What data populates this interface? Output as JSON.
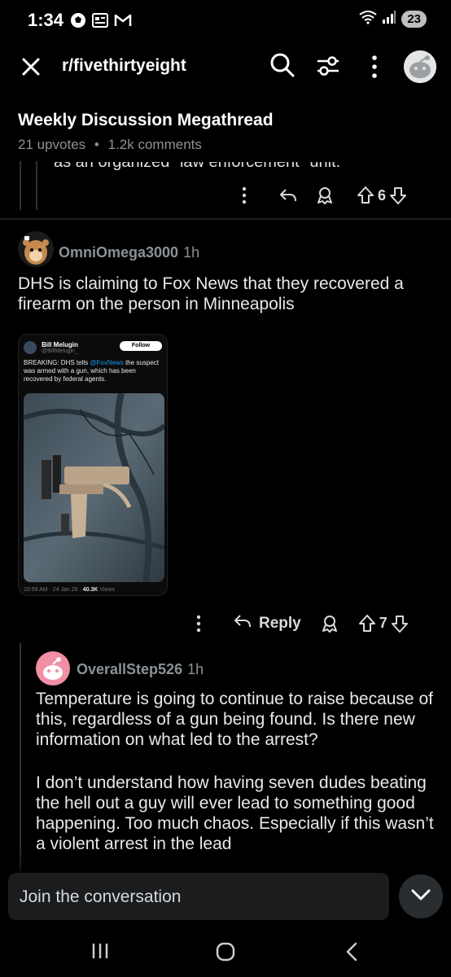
{
  "status_bar": {
    "time": "1:34",
    "battery": "23"
  },
  "header": {
    "subreddit": "r/fivethirtyeight"
  },
  "thread": {
    "title": "Weekly Discussion Megathread",
    "upvotes": "21 upvotes",
    "separator": "•",
    "comments": "1.2k comments"
  },
  "prev_comment": {
    "partial_text": "as an organized \"law enforcement\" unit.",
    "vote_count": "6"
  },
  "comment": {
    "username": "OmniOmega3000",
    "age": "1h",
    "body": "DHS is claiming to Fox News that they recovered a firearm on the person in Minneapolis",
    "reply_label": "Reply",
    "vote_count": "7",
    "embed": {
      "author": "Bill Melugin",
      "handle": "@BillMelugin_",
      "follow_label": "Follow",
      "text_prefix": "BREAKING: DHS tells",
      "mention": "@FoxNews",
      "text_suffix": "the suspect was armed with a gun, which has been recovered by federal agents.",
      "timestamp": "10:59 AM · 24 Jan 26 ·",
      "views": "40.3K",
      "views_label": "Views"
    }
  },
  "reply": {
    "username": "OverallStep526",
    "age": "1h",
    "paragraph1": "Temperature is going to continue to raise because of this, regardless of a gun being found. Is there new information on what led to the arrest?",
    "paragraph2": "I don’t understand how having seven dudes beating the hell out a guy will ever lead to something good happening. Too much chaos. Especially if this wasn’t a violent arrest in the lead"
  },
  "composer": {
    "placeholder": "Join the conversation"
  },
  "colors": {
    "background": "#000000",
    "text": "#d7dadc",
    "muted": "#8b9296",
    "input_bg": "#1a1c1e",
    "link_blue": "#1d9bf0"
  }
}
